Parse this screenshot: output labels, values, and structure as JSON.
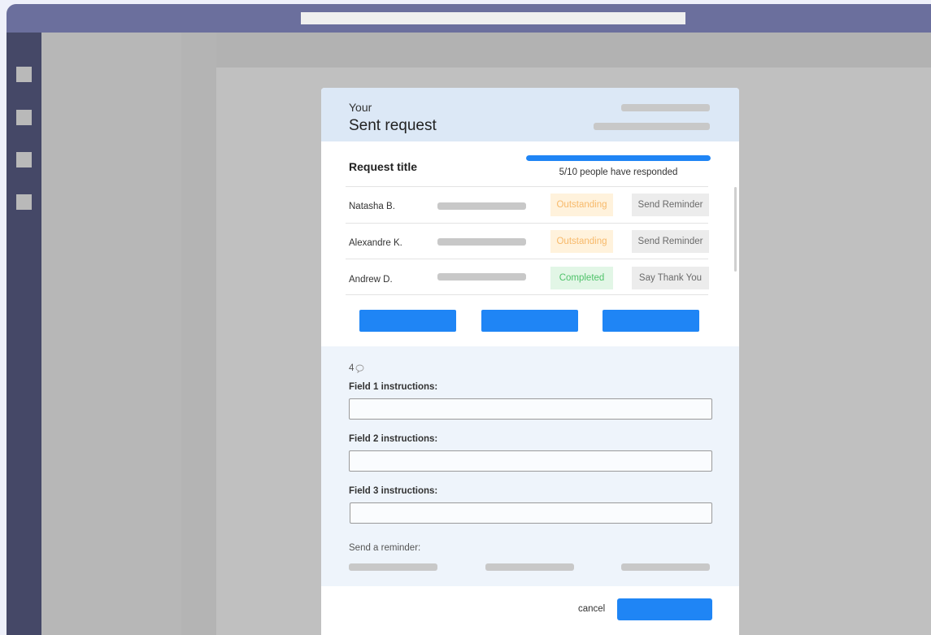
{
  "header": {
    "subtitle": "Your",
    "title": "Sent request"
  },
  "request": {
    "title": "Request title",
    "progress_fraction": 1.0,
    "responded_text": "5/10 people have responded"
  },
  "rows": [
    {
      "name": "Natasha B.",
      "status": "Outstanding",
      "action": "Send Reminder"
    },
    {
      "name": "Alexandre K.",
      "status": "Outstanding",
      "action": "Send Reminder"
    },
    {
      "name": "Andrew D.",
      "status": "Completed",
      "action": "Say Thank You"
    }
  ],
  "comments": {
    "count": "4",
    "icon": "speech-bubble-icon"
  },
  "fields": [
    {
      "label": "Field 1 instructions:",
      "value": ""
    },
    {
      "label": "Field 2 instructions:",
      "value": ""
    },
    {
      "label": "Field 3 instructions:",
      "value": ""
    }
  ],
  "reminder": {
    "label": "Send a reminder:"
  },
  "footer": {
    "cancel_label": "cancel"
  },
  "colors": {
    "titlebar": "#6b6f9d",
    "rail": "#454867",
    "accent": "#1f85f5",
    "outstanding_text": "#f7b96a",
    "outstanding_bg": "#fff2dc",
    "completed_text": "#4fc26a",
    "completed_bg": "#e2f6e6",
    "header_bg": "#dce8f6"
  }
}
